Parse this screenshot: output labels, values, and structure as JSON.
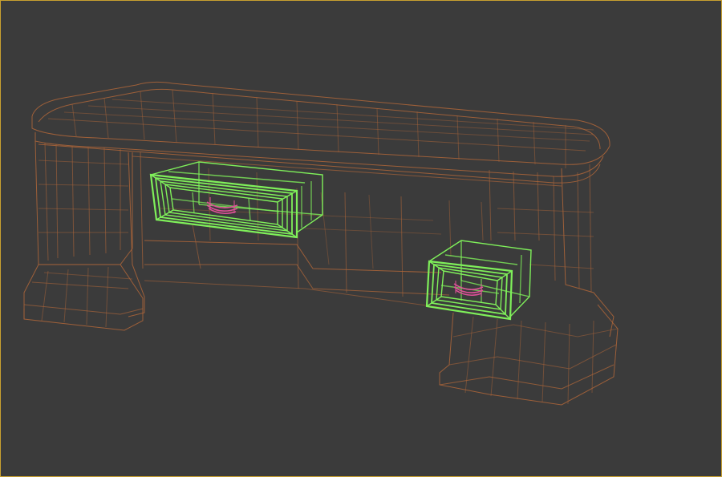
{
  "viewport": {
    "background": "#3b3b3b",
    "border_color": "#c8a030",
    "render_mode": "wireframe"
  },
  "objects": {
    "desk_body": {
      "wire_color": "#a8643a"
    },
    "drawer_left": {
      "wire_color": "#7ff05a",
      "selected": true
    },
    "drawer_right": {
      "wire_color": "#7ff05a",
      "selected": true
    },
    "drawer_handle_left": {
      "wire_color": "#e0509a"
    },
    "drawer_handle_right": {
      "wire_color": "#e0509a"
    }
  }
}
